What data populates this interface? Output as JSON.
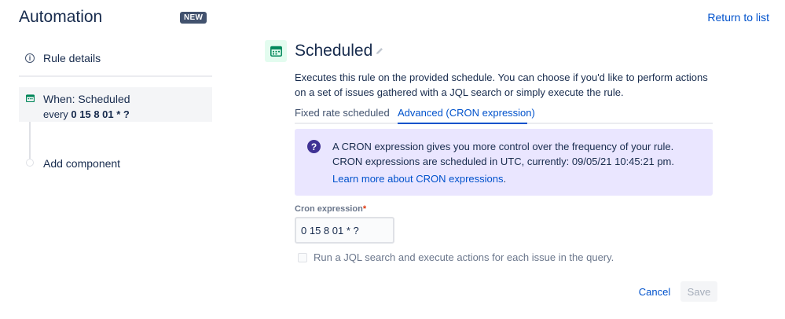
{
  "app": {
    "title": "Automation",
    "badge": "NEW",
    "return_link": "Return to list"
  },
  "sidebar": {
    "rule_details": "Rule details",
    "trigger": {
      "title": "When: Scheduled",
      "prefix": "every ",
      "expression": "0 15 8 01 * ?"
    },
    "add_component": "Add component"
  },
  "panel": {
    "title": "Scheduled",
    "description": "Executes this rule on the provided schedule. You can choose if you'd like to perform actions on a set of issues gathered with a JQL search or simply execute the rule.",
    "tabs": [
      {
        "label": "Fixed rate scheduled",
        "active": false
      },
      {
        "label": "Advanced (CRON expression)",
        "active": true
      }
    ],
    "info": {
      "text": "A CRON expression gives you more control over the frequency of your rule. CRON expressions are scheduled in UTC, currently: 09/05/21 10:45:21 pm.",
      "link": "Learn more about CRON expressions",
      "link_suffix": "."
    },
    "cron_field": {
      "label": "Cron expression",
      "required_mark": "*",
      "value": "0 15 8 01 * ?"
    },
    "jql_checkbox": {
      "label": "Run a JQL search and execute actions for each issue in the query.",
      "checked": false
    },
    "buttons": {
      "cancel": "Cancel",
      "save": "Save"
    }
  },
  "colors": {
    "accent": "#0052cc",
    "info_bg": "#eae6ff",
    "info_icon": "#403294",
    "calendar": "#00875a"
  },
  "icons": [
    "info-icon",
    "calendar-icon",
    "pencil-icon",
    "question-icon"
  ]
}
